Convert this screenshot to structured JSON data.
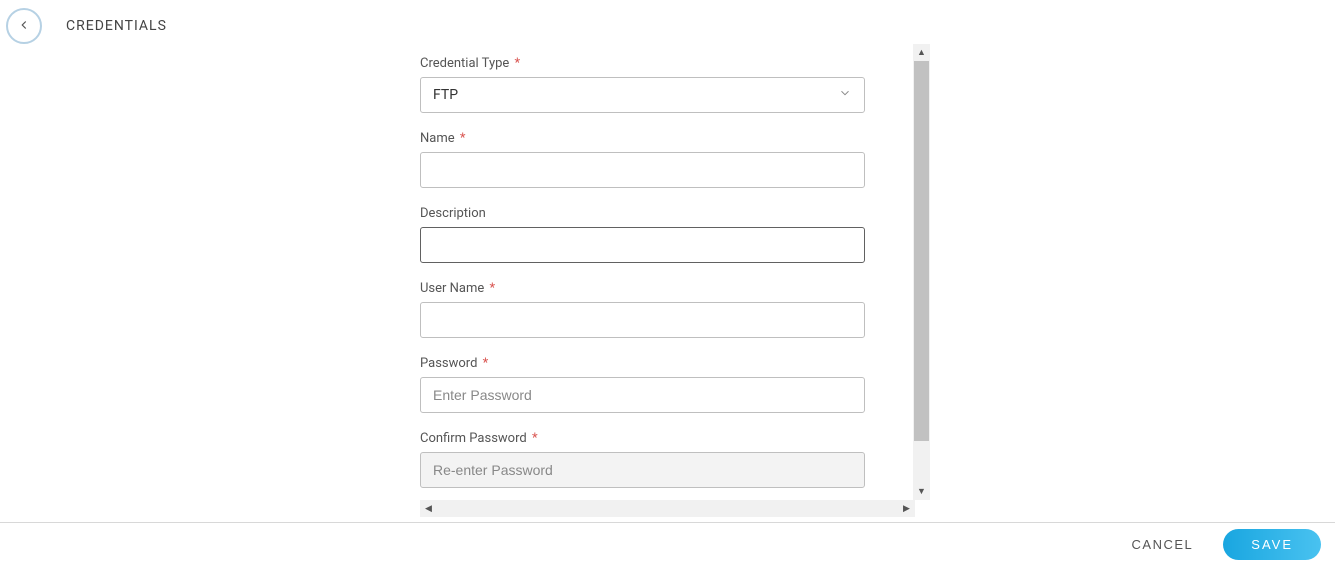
{
  "header": {
    "title": "CREDENTIALS"
  },
  "form": {
    "credential_type": {
      "label": "Credential Type",
      "required": "*",
      "value": "FTP"
    },
    "name": {
      "label": "Name",
      "required": "*",
      "value": ""
    },
    "description": {
      "label": "Description",
      "value": ""
    },
    "user_name": {
      "label": "User Name",
      "required": "*",
      "value": ""
    },
    "password": {
      "label": "Password",
      "required": "*",
      "placeholder": "Enter Password",
      "value": ""
    },
    "confirm_password": {
      "label": "Confirm Password",
      "required": "*",
      "placeholder": "Re-enter Password",
      "value": ""
    }
  },
  "footer": {
    "cancel_label": "CANCEL",
    "save_label": "SAVE"
  }
}
